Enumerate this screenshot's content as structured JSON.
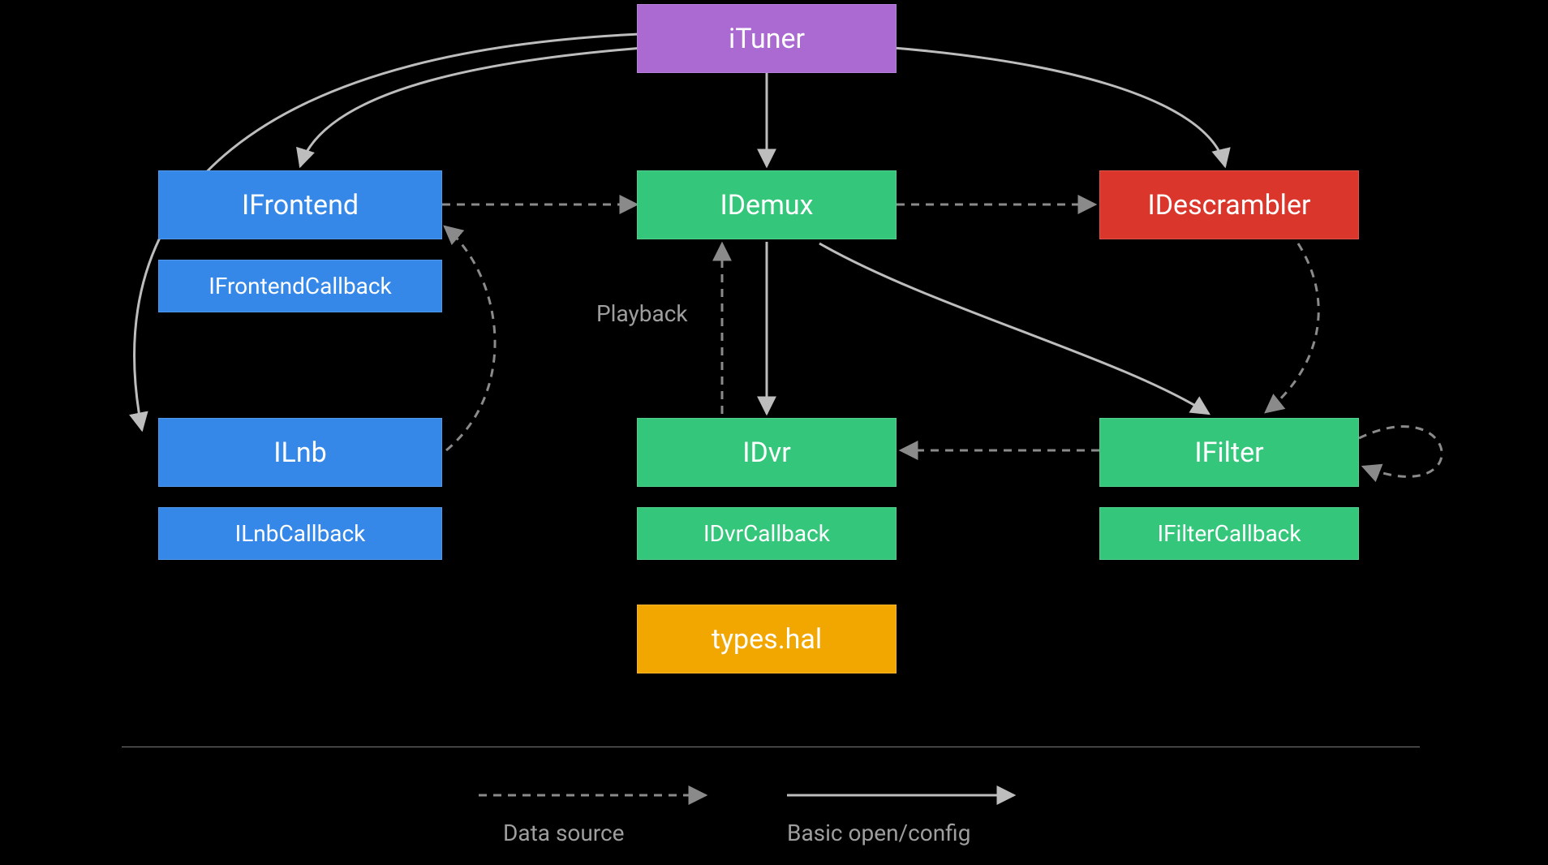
{
  "nodes": {
    "ituner": "iTuner",
    "ifrontend": "IFrontend",
    "ifrontend_cb": "IFrontendCallback",
    "ilnb": "ILnb",
    "ilnb_cb": "ILnbCallback",
    "idemux": "IDemux",
    "idvr": "IDvr",
    "idvr_cb": "IDvrCallback",
    "types": "types.hal",
    "idescrambler": "IDescrambler",
    "ifilter": "IFilter",
    "ifilter_cb": "IFilterCallback"
  },
  "labels": {
    "playback": "Playback",
    "legend_dashed": "Data source",
    "legend_solid": "Basic open/config"
  },
  "colors": {
    "purple": "#ab6ad1",
    "blue": "#3688e8",
    "green": "#34c67a",
    "red": "#db362c",
    "orange": "#f2a600",
    "edge": "#bdbdbd",
    "edge_dashed": "#8a8a8a",
    "label": "#9e9e9e"
  },
  "edges": {
    "solid": [
      {
        "from": "iTuner",
        "to": "IDemux"
      },
      {
        "from": "iTuner",
        "to": "IFrontend"
      },
      {
        "from": "iTuner",
        "to": "IDescrambler"
      },
      {
        "from": "iTuner",
        "to": "ILnb"
      },
      {
        "from": "IDemux",
        "to": "IDvr"
      },
      {
        "from": "IDemux",
        "to": "IFilter"
      }
    ],
    "dashed": [
      {
        "from": "IFrontend",
        "to": "IDemux"
      },
      {
        "from": "IDemux",
        "to": "IDescrambler"
      },
      {
        "from": "ILnb",
        "to": "IFrontend"
      },
      {
        "from": "IDvr",
        "to": "IDemux",
        "label": "Playback"
      },
      {
        "from": "IFilter",
        "to": "IDvr"
      },
      {
        "from": "IDescrambler",
        "to": "IFilter"
      },
      {
        "from": "IFilter",
        "to": "IFilter"
      }
    ]
  }
}
